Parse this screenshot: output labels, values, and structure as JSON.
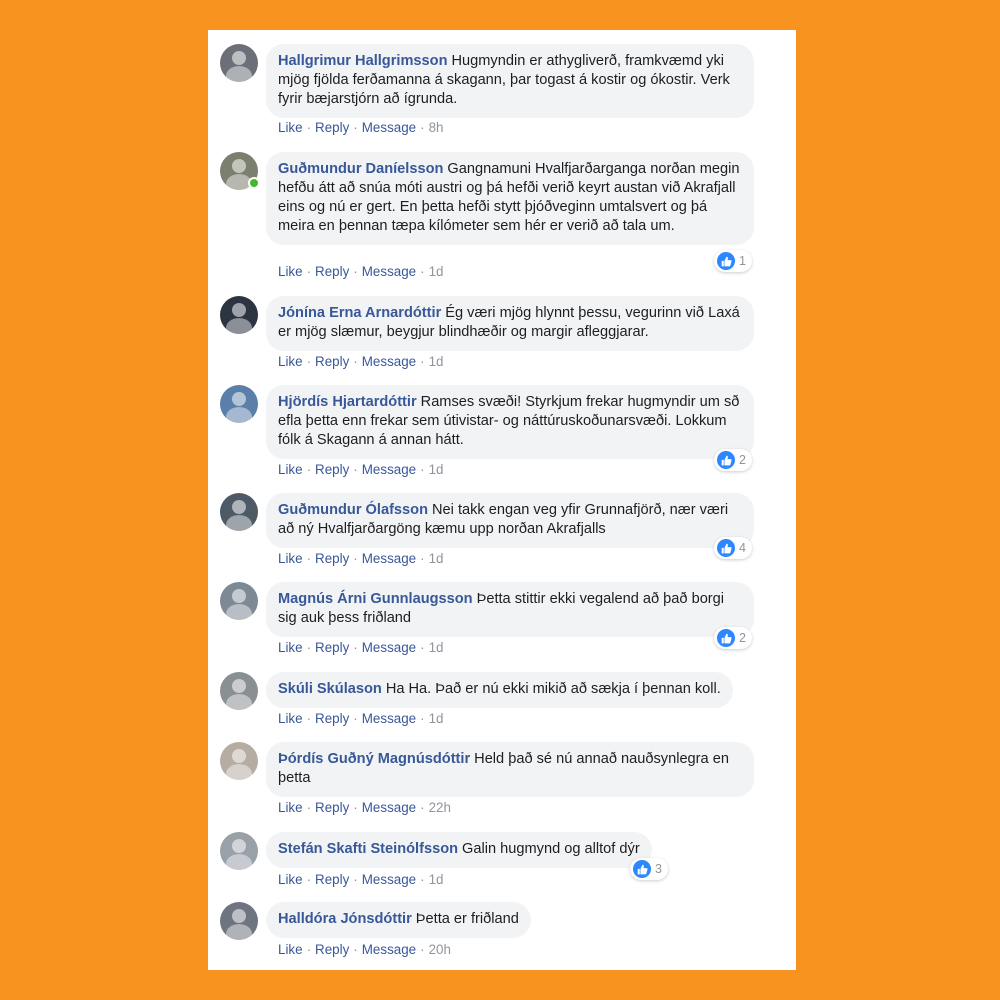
{
  "comments": [
    {
      "author": "Hallgrimur Hallgrimsson",
      "text": "Hugmyndin er athygliverð, framkvæmd yki mjög fjölda ferðamanna á skagann, þar togast á kostir og ókostir. Verk fyrir bæjarstjórn að ígrunda.",
      "time": "8h",
      "avatar_color": "#6b6f78"
    },
    {
      "author": "Guðmundur Daníelsson",
      "text": "Gangnamuni Hvalfjarðarganga norðan megin hefðu átt að snúa móti austri og þá hefði verið keyrt austan við Akrafjall eins og nú er gert. En þetta hefði stytt þjóðveginn umtalsvert og þá meira en þennan tæpa kílómeter sem hér er verið að tala um.",
      "time": "1d",
      "likes": "1",
      "avatar_color": "#7a7f6e"
    },
    {
      "author": "Jónína Erna Arnardóttir",
      "text": "Ég væri mjög hlynnt þessu, vegurinn við Laxá er mjög slæmur, beygjur blindhæðir og margir afleggjarar.",
      "time": "1d",
      "avatar_color": "#2c3442"
    },
    {
      "author": "Hjördís Hjartardóttir",
      "text": "Ramses svæði! Styrkjum frekar hugmyndir um sð efla þetta enn frekar sem útivistar- og náttúruskoðunarsvæði. Lokkum fólk á Skagann á annan hátt.",
      "time": "1d",
      "likes": "2",
      "avatar_color": "#5a7fa8"
    },
    {
      "author": "Guðmundur Ólafsson",
      "text": "Nei takk engan veg yfir Grunnafjörð, nær væri að ný Hvalfjarðargöng kæmu upp norðan Akrafjalls",
      "time": "1d",
      "likes": "4",
      "avatar_color": "#4d5a66"
    },
    {
      "author": "Magnús Árni Gunnlaugsson",
      "text": "Þetta stittir ekki vegalend að það borgi sig auk þess friðland",
      "time": "1d",
      "likes": "2",
      "avatar_color": "#7d8a96"
    },
    {
      "author": "Skúli Skúlason",
      "text": "Ha Ha. Það er nú ekki mikið að sækja í þennan koll.",
      "time": "1d",
      "avatar_color": "#8a8f94"
    },
    {
      "author": "Þórdís Guðný Magnúsdóttir",
      "text": "Held það sé nú annað nauðsynlegra en þetta",
      "time": "22h",
      "avatar_color": "#b5aca2"
    },
    {
      "author": "Stefán Skafti Steinólfsson",
      "text": "Galin hugmynd og alltof dýr",
      "time": "1d",
      "likes": "3",
      "avatar_color": "#9aa0a8"
    },
    {
      "author": "Halldóra Jónsdóttir",
      "text": "Þetta er friðland",
      "time": "20h",
      "avatar_color": "#6e7480"
    }
  ],
  "actions": {
    "like": "Like",
    "reply": "Reply",
    "message": "Message",
    "separator": "·"
  },
  "colors": {
    "background": "#f7931e",
    "author": "#385898",
    "bubble": "#f2f3f5",
    "like_icon": "#2d88ff",
    "online": "#42b72a"
  }
}
